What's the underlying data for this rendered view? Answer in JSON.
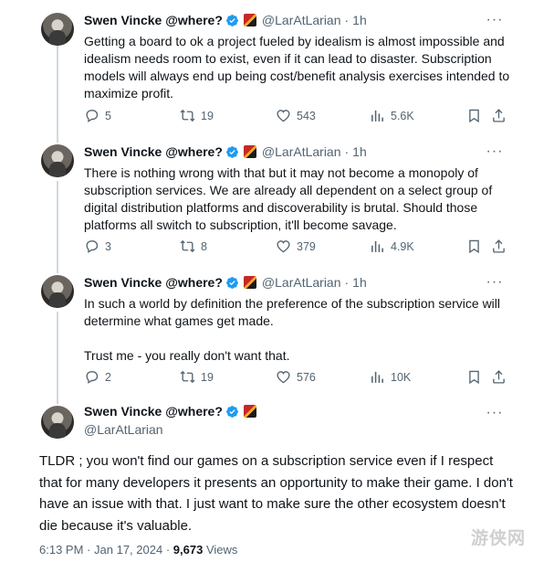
{
  "tweets": [
    {
      "name": "Swen Vincke @where?",
      "handle": "@LarAtLarian",
      "time": "1h",
      "text": [
        "Getting a board to ok a project fueled by idealism is almost impossible and idealism needs room to exist, even if it can lead to disaster. Subscription models will always end up being cost/benefit analysis exercises intended to maximize profit."
      ],
      "replies": "5",
      "reposts": "19",
      "likes": "543",
      "views": "5.6K"
    },
    {
      "name": "Swen Vincke @where?",
      "handle": "@LarAtLarian",
      "time": "1h",
      "text": [
        "There is nothing wrong with that but it may not become a monopoly of subscription services. We are already all dependent on a select group of digital distribution platforms and discoverability is brutal. Should those platforms all switch to subscription, it'll become savage."
      ],
      "replies": "3",
      "reposts": "8",
      "likes": "379",
      "views": "4.9K"
    },
    {
      "name": "Swen Vincke @where?",
      "handle": "@LarAtLarian",
      "time": "1h",
      "text": [
        "In such a world by definition the preference of the subscription service will determine what games get made.",
        "Trust me - you really don't want that."
      ],
      "replies": "2",
      "reposts": "19",
      "likes": "576",
      "views": "10K"
    }
  ],
  "main_tweet": {
    "name": "Swen Vincke @where?",
    "handle": "@LarAtLarian",
    "text": "TLDR ; you won't find our games on a subscription service even if I respect that for many developers it presents an opportunity to make their game. I don't have an issue with that. I just want to make sure the other ecosystem doesn't die because it's valuable.",
    "time": "6:13 PM",
    "date": "Jan 17, 2024",
    "separator": "·",
    "views_count": "9,673",
    "views_label": "Views"
  },
  "watermark": "游侠网",
  "colors": {
    "verified": "#1d9bf0",
    "muted": "#536471",
    "rail": "#cfd9de"
  }
}
